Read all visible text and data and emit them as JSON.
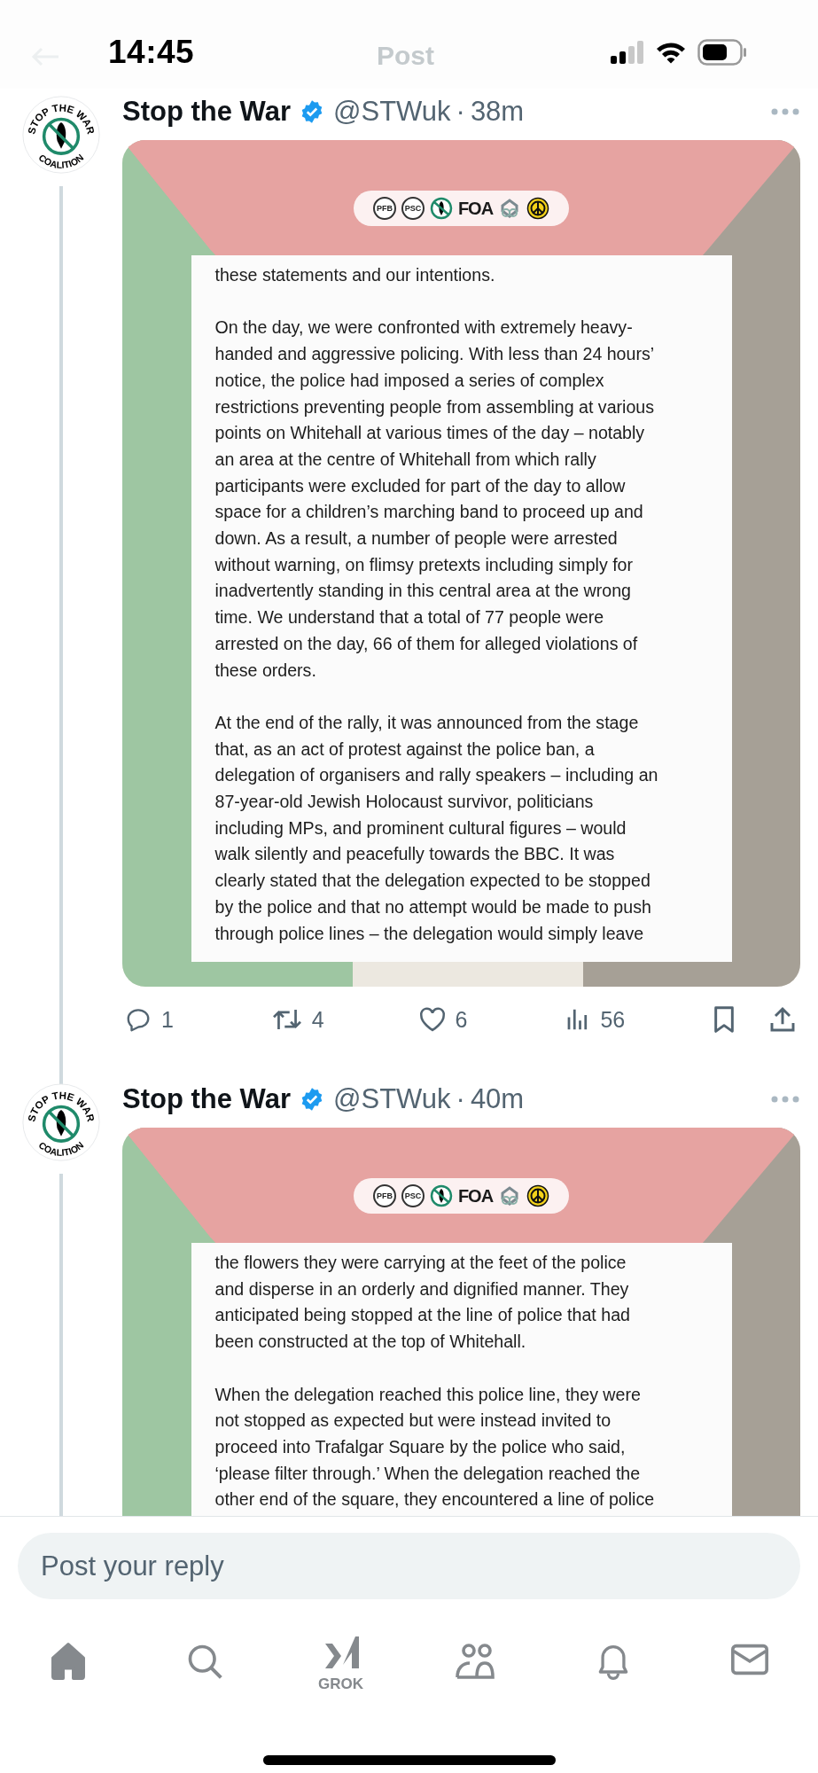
{
  "status_bar": {
    "time": "14:45"
  },
  "header": {
    "title": "Post"
  },
  "posts": [
    {
      "name": "Stop the War",
      "verified": true,
      "handle": "@STWuk",
      "separator": "·",
      "age": "38m",
      "avatar_text": [
        "STOP THE WAR",
        "COALITION"
      ],
      "logos": [
        "PFB",
        "PSC",
        "FOA"
      ],
      "document": [
        [
          "these statements and our intentions."
        ],
        [
          "On the day, we were confronted with extremely heavy-",
          "handed and aggressive policing. With less than 24 hours’",
          "notice, the police had imposed a series of complex",
          "restrictions preventing people from assembling at various",
          "points on Whitehall at various times of the day – notably",
          "an area at the centre of Whitehall from which rally",
          "participants were excluded for part of the day to allow",
          "space for a children’s marching band to proceed up and",
          "down. As a result, a number of people were arrested",
          "without warning, on flimsy pretexts including simply for",
          "inadvertently standing in this central area at the wrong",
          "time. We understand that a total of 77 people were",
          "arrested on the day, 66 of them for alleged violations of",
          "these orders."
        ],
        [
          "At the end of the rally, it was announced from the stage",
          "that, as an act of protest against the police ban, a",
          "delegation of organisers and rally speakers – including an",
          "87-year-old Jewish Holocaust survivor, politicians",
          "including MPs, and prominent cultural figures – would",
          "walk silently and peacefully towards the BBC. It was",
          "clearly stated that the delegation expected to be stopped",
          "by the police and that no attempt would be made to push",
          "through police lines – the delegation would simply leave"
        ]
      ],
      "actions": [
        {
          "kind": "reply",
          "count": "1"
        },
        {
          "kind": "repost",
          "count": "4"
        },
        {
          "kind": "like",
          "count": "6"
        },
        {
          "kind": "views",
          "count": "56"
        },
        {
          "kind": "bookmark"
        },
        {
          "kind": "share"
        }
      ]
    },
    {
      "name": "Stop the War",
      "verified": true,
      "handle": "@STWuk",
      "separator": "·",
      "age": "40m",
      "avatar_text": [
        "STOP THE WAR",
        "COALITION"
      ],
      "logos": [
        "PFB",
        "PSC",
        "FOA"
      ],
      "document": [
        [
          "the flowers they were carrying at the feet of the police",
          "and disperse in an orderly and dignified manner. They",
          "anticipated being stopped at the line of police that had",
          "been constructed at the top of Whitehall."
        ],
        [
          "When the delegation reached this police line, they were",
          "not stopped as expected but were instead invited to",
          "proceed into Trafalgar Square by the police who said,",
          "‘please filter through.’ When the delegation reached the",
          "other end of the square, they encountered a line of police"
        ]
      ]
    }
  ],
  "reply": {
    "placeholder": "Post your reply"
  },
  "nav": [
    {
      "kind": "home",
      "selected": true
    },
    {
      "kind": "search",
      "selected": false
    },
    {
      "kind": "grok",
      "label": "GROK",
      "selected": false
    },
    {
      "kind": "communities",
      "selected": false
    },
    {
      "kind": "notifications",
      "selected": false
    },
    {
      "kind": "messages",
      "selected": false
    }
  ]
}
